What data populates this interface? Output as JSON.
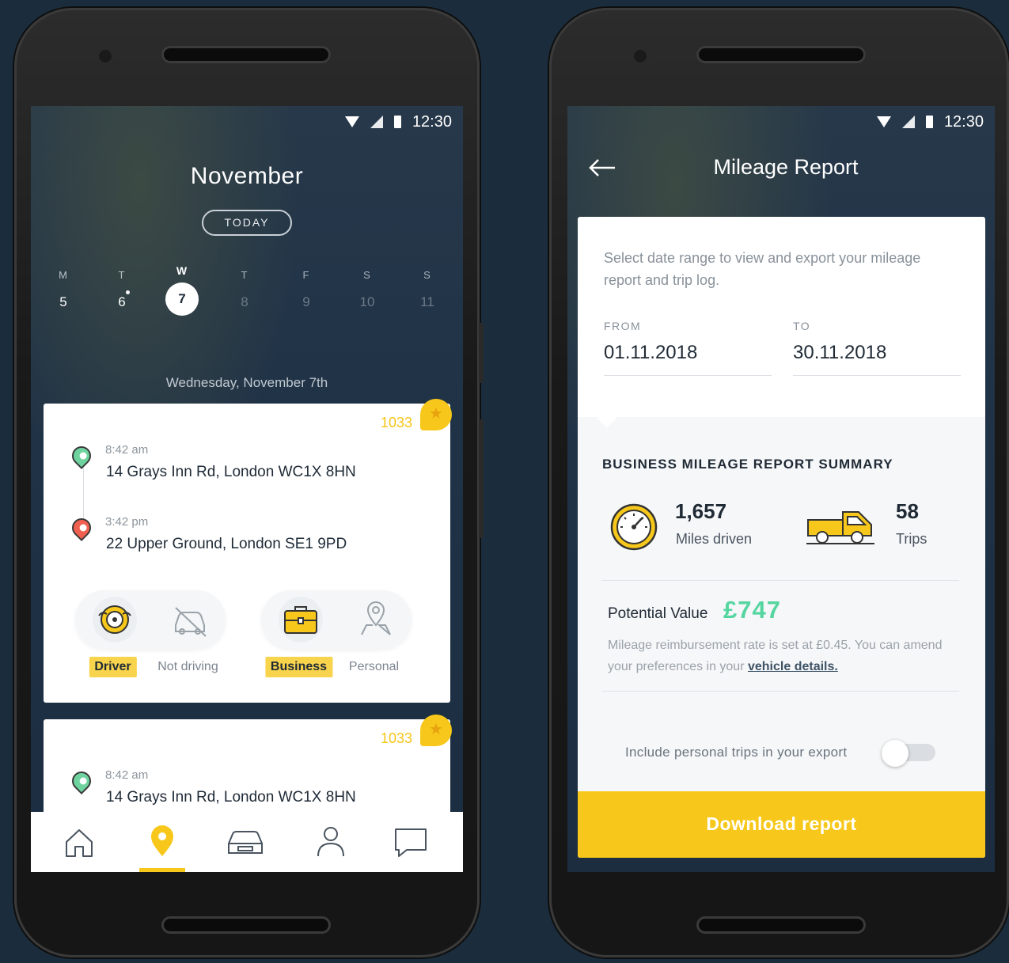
{
  "status_bar": {
    "time": "12:30"
  },
  "calendar": {
    "month": "November",
    "today_label": "TODAY",
    "days": [
      {
        "letter": "M",
        "number": "5"
      },
      {
        "letter": "T",
        "number": "6"
      },
      {
        "letter": "W",
        "number": "7"
      },
      {
        "letter": "T",
        "number": "8"
      },
      {
        "letter": "F",
        "number": "9"
      },
      {
        "letter": "S",
        "number": "10"
      },
      {
        "letter": "S",
        "number": "11"
      }
    ],
    "selected_date": "Wednesday, November 7th"
  },
  "trips": [
    {
      "score": "1033",
      "start": {
        "time": "8:42 am",
        "address": "14 Grays Inn Rd, London WC1X 8HN"
      },
      "end": {
        "time": "3:42 pm",
        "address": "22 Upper Ground, London SE1 9PD"
      },
      "role_options": [
        "Driver",
        "Not driving"
      ],
      "purpose_options": [
        "Business",
        "Personal"
      ],
      "selected_role": "Driver",
      "selected_purpose": "Business"
    },
    {
      "score": "1033",
      "start": {
        "time": "8:42 am",
        "address": "14 Grays Inn Rd, London WC1X 8HN"
      }
    }
  ],
  "tabbar": {
    "tabs": [
      "home-icon",
      "location-pin-icon",
      "car-icon",
      "profile-icon",
      "chat-icon"
    ],
    "active_tab": "location-pin-icon"
  },
  "report": {
    "title": "Mileage Report",
    "intro": "Select date range to view and export your mileage report and trip log.",
    "from_label": "FROM",
    "from_value": "01.11.2018",
    "to_label": "TO",
    "to_value": "30.11.2018",
    "summary_title": "BUSINESS MILEAGE REPORT SUMMARY",
    "miles_value": "1,657",
    "miles_label": "Miles driven",
    "trips_value": "58",
    "trips_label": "Trips",
    "potential_label": "Potential Value",
    "potential_value": "£747",
    "note_text": "Mileage reimbursement rate is set at £0.45. You can amend your preferences in your ",
    "note_link": "vehicle details.",
    "include_personal_label": "Include personal trips in your export",
    "include_personal_on": false,
    "download_label": "Download report"
  },
  "colors": {
    "accent": "#f7c81b",
    "value_green": "#55d5a0",
    "background": "#1b2d3d"
  }
}
